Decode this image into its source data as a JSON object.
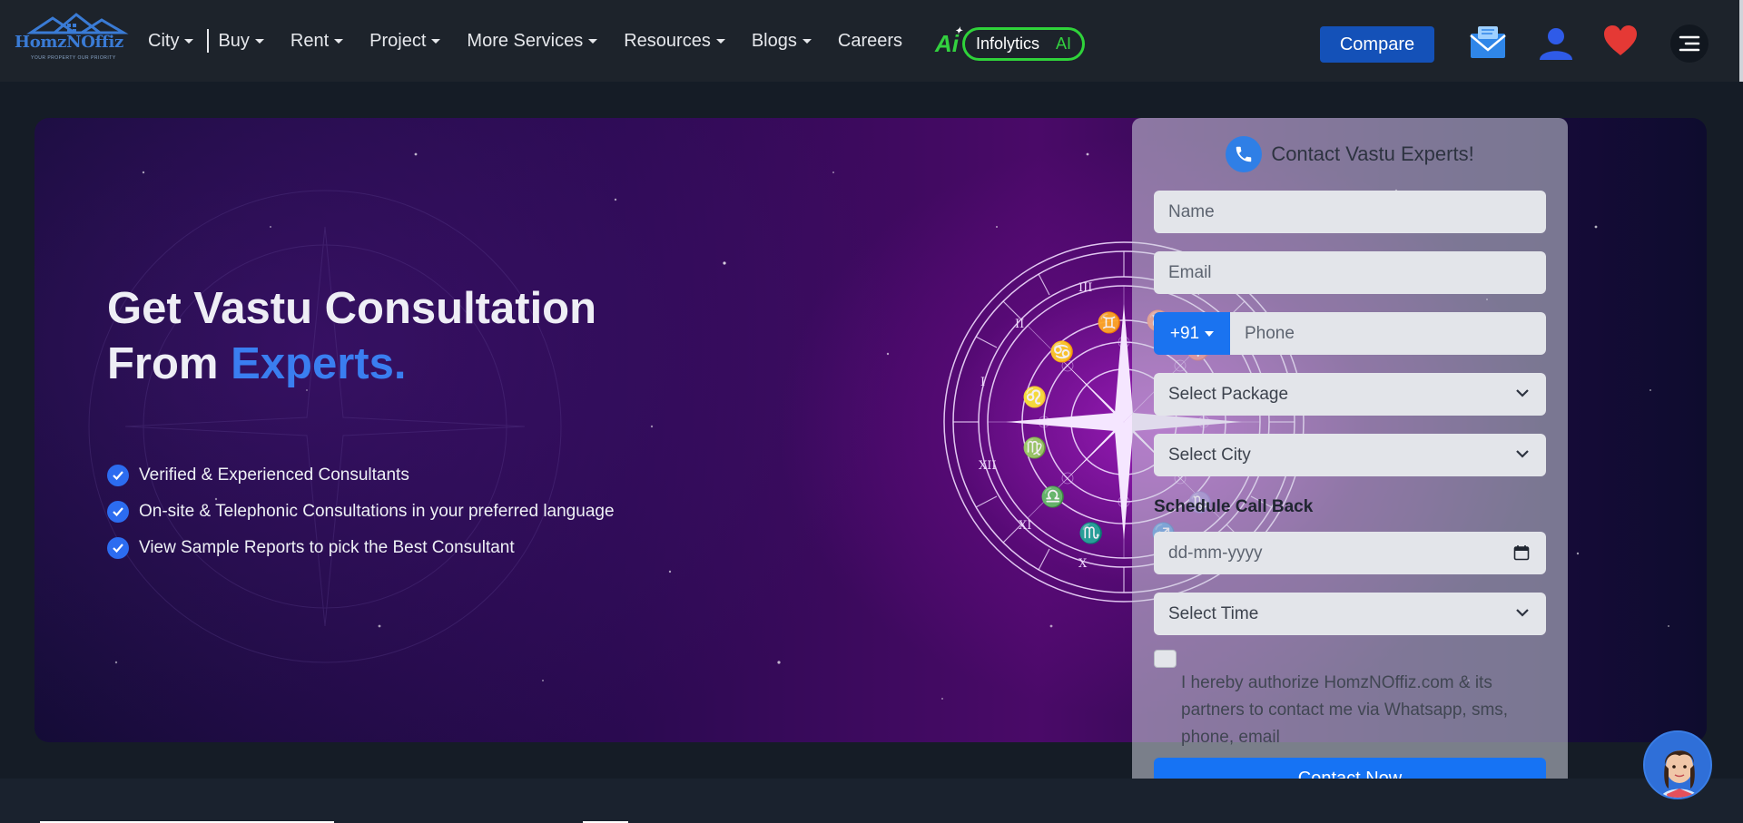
{
  "brand": {
    "logo_text": "HomzNOffiz",
    "tagline": "YOUR PROPERTY OUR PRIORITY"
  },
  "nav": {
    "items": [
      {
        "label": "City",
        "dropdown": true
      },
      {
        "label": "Buy",
        "dropdown": true
      },
      {
        "label": "Rent",
        "dropdown": true
      },
      {
        "label": "Project",
        "dropdown": true
      },
      {
        "label": "More Services",
        "dropdown": true
      },
      {
        "label": "Resources",
        "dropdown": true
      },
      {
        "label": "Blogs",
        "dropdown": true
      },
      {
        "label": "Careers",
        "dropdown": false
      }
    ],
    "ai_icon": "Ai",
    "infolytics_label": "Infolytics",
    "infolytics_ai": "AI",
    "compare_label": "Compare",
    "icons": [
      "mail-icon",
      "user-icon",
      "heart-icon",
      "menu-icon"
    ]
  },
  "hero": {
    "title_line1": "Get Vastu Consultation",
    "title_line2_prefix": "From ",
    "title_line2_accent": "Experts.",
    "features": [
      "Verified & Experienced Consultants",
      "On-site & Telephonic Consultations in your preferred language",
      "View Sample Reports to pick the Best Consultant"
    ]
  },
  "contact_form": {
    "heading": "Contact Vastu Experts!",
    "name_placeholder": "Name",
    "email_placeholder": "Email",
    "country_code": "+91",
    "phone_placeholder": "Phone",
    "package_select": "Select Package",
    "city_select": "Select City",
    "schedule_label": "Schedule Call Back",
    "date_placeholder": "dd-mm-yyyy",
    "time_select": "Select Time",
    "consent_text": "I hereby authorize HomzNOffiz.com & its partners to contact me via Whatsapp, sms, phone, email",
    "consent_checked": false,
    "submit_label": "Contact Now"
  },
  "colors": {
    "navbar_bg": "#1d232b",
    "accent_blue": "#1673f4",
    "compare_blue": "#1451b8",
    "ai_green": "#33d13f",
    "heart_red": "#e53935",
    "hero_accent": "#3a7ef0"
  }
}
